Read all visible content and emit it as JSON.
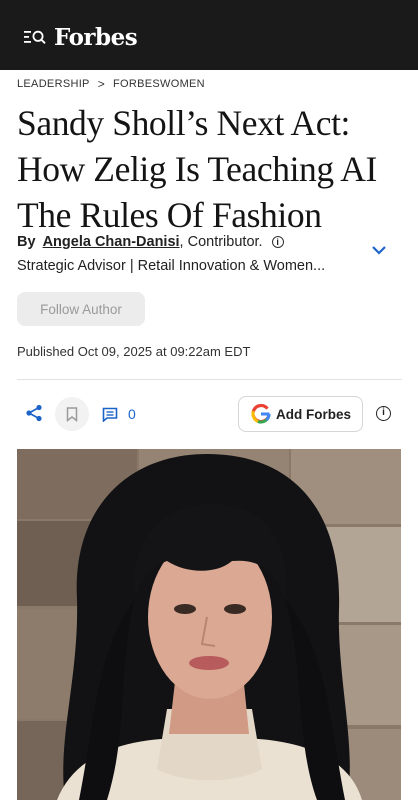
{
  "header": {
    "brand": "Forbes",
    "menu_icon": "menu-search-icon"
  },
  "breadcrumb": {
    "section": "LEADERSHIP",
    "separator": ">",
    "channel": "FORBESWOMEN"
  },
  "article": {
    "title": "Sandy Sholl’s Next Act: How Zelig Is Teaching AI The Rules Of Fashion",
    "byline_prefix": "By",
    "author": "Angela Chan-Danisi",
    "author_role": ", Contributor.",
    "author_bio": "Strategic Advisor | Retail Innovation & Women...",
    "follow_label": "Follow Author",
    "published": "Published Oct 09, 2025 at 09:22am EDT"
  },
  "actions": {
    "share_icon": "share-icon",
    "bookmark_icon": "bookmark-icon",
    "comment_icon": "comment-icon",
    "comment_count": "0",
    "add_forbes_label": "Add Forbes",
    "info_icon": "info-icon"
  },
  "colors": {
    "header_bg": "#1a1a1a",
    "link_blue": "#1d64c8"
  }
}
